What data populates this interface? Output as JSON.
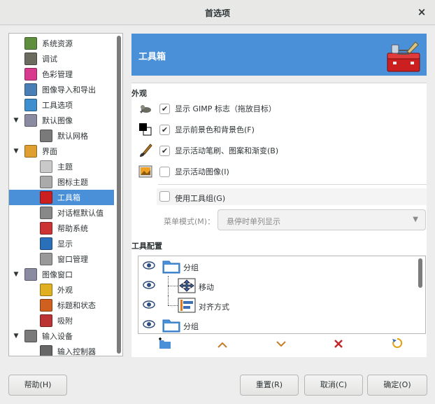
{
  "window": {
    "title": "首选项",
    "close": "×"
  },
  "tree": {
    "items": [
      {
        "label": "系统资源",
        "icon": "system-resources-icon"
      },
      {
        "label": "调试",
        "icon": "debug-icon"
      },
      {
        "label": "色彩管理",
        "icon": "color-management-icon"
      },
      {
        "label": "图像导入和导出",
        "icon": "image-import-export-icon"
      },
      {
        "label": "工具选项",
        "icon": "tool-options-icon"
      },
      {
        "label": "默认图像",
        "icon": "default-image-icon",
        "expander": "▼"
      },
      {
        "label": "默认网格",
        "icon": "default-grid-icon"
      },
      {
        "label": "界面",
        "icon": "interface-icon",
        "expander": "▼"
      },
      {
        "label": "主题",
        "icon": "theme-icon"
      },
      {
        "label": "图标主题",
        "icon": "icon-theme-icon"
      },
      {
        "label": "工具箱",
        "icon": "toolbox-icon",
        "selected": true
      },
      {
        "label": "对话框默认值",
        "icon": "dialog-defaults-icon"
      },
      {
        "label": "帮助系统",
        "icon": "help-system-icon"
      },
      {
        "label": "显示",
        "icon": "display-icon"
      },
      {
        "label": "窗口管理",
        "icon": "window-management-icon"
      },
      {
        "label": "图像窗口",
        "icon": "image-windows-icon",
        "expander": "▼"
      },
      {
        "label": "外观",
        "icon": "appearance-icon"
      },
      {
        "label": "标题和状态",
        "icon": "title-status-icon"
      },
      {
        "label": "吸附",
        "icon": "snapping-icon"
      },
      {
        "label": "输入设备",
        "icon": "input-devices-icon",
        "expander": "▼"
      },
      {
        "label": "输入控制器",
        "icon": "input-controllers-icon"
      }
    ]
  },
  "header": {
    "title": "工具箱"
  },
  "appearance": {
    "section": "外观",
    "options": [
      {
        "label": "显示 GIMP 标志（拖放目标）",
        "checked": "✔"
      },
      {
        "label": "显示前景色和背景色(F)",
        "checked": "✔"
      },
      {
        "label": "显示活动笔刷、图案和渐变(B)",
        "checked": "✔"
      },
      {
        "label": "显示活动图像(I)",
        "checked": ""
      }
    ],
    "use_groups": "使用工具组(G)",
    "menu_mode_label": "菜单模式(M)：",
    "menu_mode_value": "悬停时单列显示"
  },
  "tool_config": {
    "section": "工具配置",
    "rows": [
      {
        "label": "分组"
      },
      {
        "label": "移动"
      },
      {
        "label": "对齐方式"
      },
      {
        "label": "分组"
      }
    ]
  },
  "buttons": {
    "help": "帮助(H)",
    "reset": "重置(R)",
    "cancel": "取消(C)",
    "ok": "确定(O)"
  },
  "colors": {
    "accent": "#4a90d9"
  }
}
